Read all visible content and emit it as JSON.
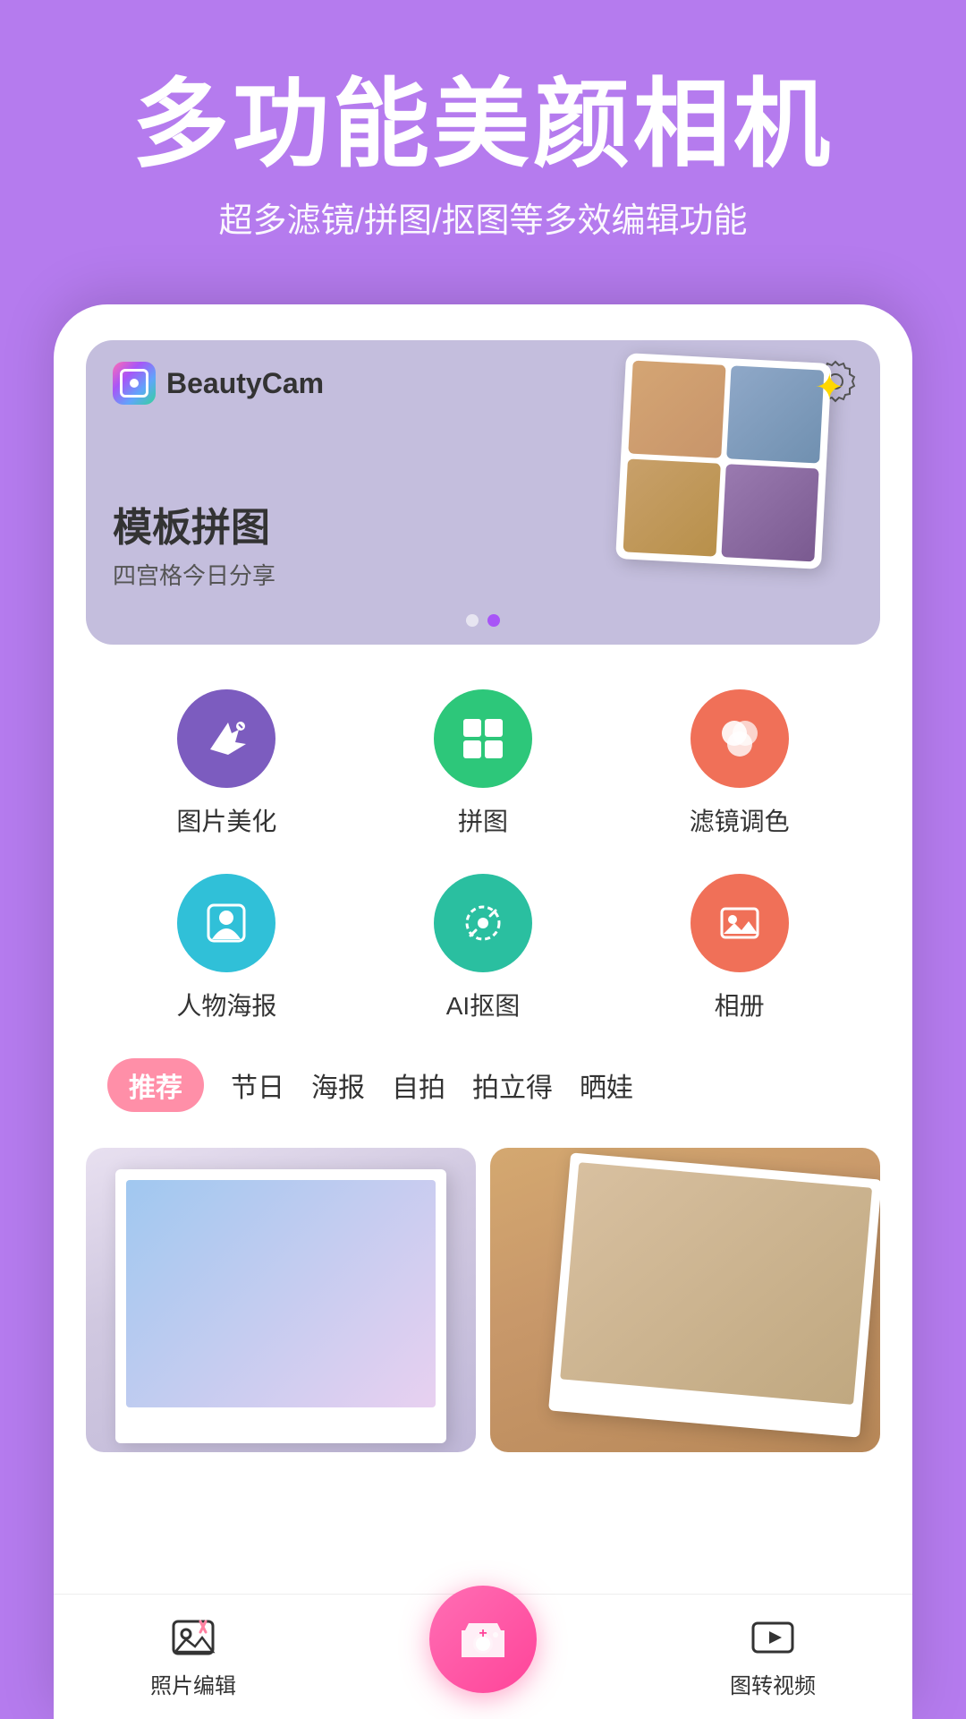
{
  "hero": {
    "title": "多功能美颜相机",
    "subtitle": "超多滤镜/拼图/抠图等多效编辑功能"
  },
  "banner": {
    "app_name": "BeautyCam",
    "main_text": "模板拼图",
    "sub_text": "四宫格今日分享",
    "dots": [
      false,
      true
    ]
  },
  "features": [
    {
      "label": "图片美化",
      "icon": "magic-wand-icon",
      "color_class": "icon-purple"
    },
    {
      "label": "拼图",
      "icon": "grid-icon",
      "color_class": "icon-green"
    },
    {
      "label": "滤镜调色",
      "icon": "filter-icon",
      "color_class": "icon-orange"
    },
    {
      "label": "人物海报",
      "icon": "portrait-icon",
      "color_class": "icon-teal"
    },
    {
      "label": "AI抠图",
      "icon": "cutout-icon",
      "color_class": "icon-teal2"
    },
    {
      "label": "相册",
      "icon": "album-icon",
      "color_class": "icon-orange2"
    }
  ],
  "tags": [
    {
      "label": "推荐",
      "active": true
    },
    {
      "label": "节日",
      "active": false
    },
    {
      "label": "海报",
      "active": false
    },
    {
      "label": "自拍",
      "active": false
    },
    {
      "label": "拍立得",
      "active": false
    },
    {
      "label": "晒娃",
      "active": false
    }
  ],
  "bottom_nav": [
    {
      "label": "照片编辑",
      "icon": "photo-edit-icon"
    },
    {
      "label": "",
      "icon": "camera-icon",
      "is_camera": true
    },
    {
      "label": "图转视频",
      "icon": "video-icon"
    }
  ]
}
